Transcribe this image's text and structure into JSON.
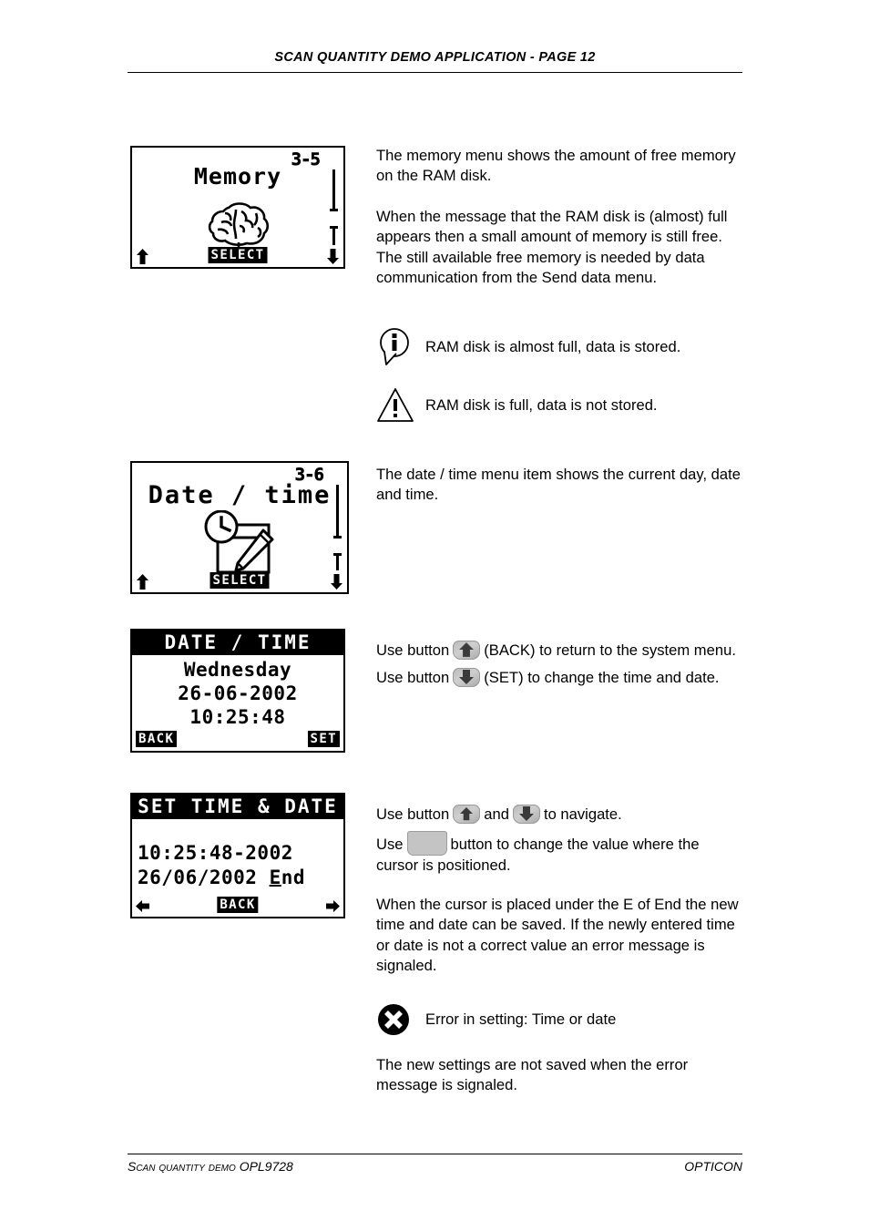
{
  "header": {
    "title": "SCAN QUANTITY DEMO APPLICATION  -   PAGE 12"
  },
  "footer": {
    "left_smallcaps": "Scan quantity demo ",
    "left_model": "OPL9728",
    "right": "OPTICON"
  },
  "screens": [
    {
      "id": "memory-menu",
      "page_no": "3-5",
      "title": "Memory",
      "icon": "brain-icon",
      "softkey_center": "SELECT",
      "arrow_left": "up-arrow",
      "arrow_right": "down-arrow",
      "scrollbar": true
    },
    {
      "id": "date-time-menu",
      "page_no": "3-6",
      "title": "Date / time",
      "icon": "clock-calendar-pencil-icon",
      "softkey_center": "SELECT",
      "arrow_left": "up-arrow",
      "arrow_right": "down-arrow",
      "scrollbar": true
    },
    {
      "id": "date-time-display",
      "bar_title": "DATE / TIME",
      "lines": [
        "Wednesday",
        "26-06-2002",
        "10:25:48"
      ],
      "softkey_left": "BACK",
      "softkey_right": "SET"
    },
    {
      "id": "set-time-date",
      "bar_title": "SET TIME & DATE",
      "line1": "10:25:48-2002",
      "line2_prefix": "26/06/2002 ",
      "line2_cursor": "E",
      "line2_suffix": "nd",
      "softkey_center": "BACK",
      "arrow_left": "left-arrow",
      "arrow_right": "right-arrow"
    }
  ],
  "sections": {
    "memory": {
      "p1": "The memory menu shows the amount of free memory on the RAM disk.",
      "p2": "When the message that the RAM disk is (almost) full appears then a small amount of memory is still free. The still available free memory is needed by data communication from the Send data menu.",
      "note_info": "RAM disk is almost full, data is stored.",
      "note_warning": "RAM disk is full, data is not stored."
    },
    "datetime": {
      "p1": "The date / time menu item shows the current day, date and time."
    },
    "datetime_buttons": {
      "use_button_1_pre": "Use button",
      "use_button_1_post": "(BACK) to return to the system menu.",
      "use_button_2_pre": "Use button",
      "use_button_2_post": "(SET) to change the time and date."
    },
    "settime": {
      "nav_pre": "Use button",
      "nav_mid": "and",
      "nav_post": "to navigate.",
      "value_pre": "Use",
      "value_post": "button to change the value where the cursor is positioned.",
      "p1": "When the cursor is placed under the E of End the new time and date can be saved. If the newly entered time or date is not a correct value an error message is signaled.",
      "note_error": "Error in setting: Time or date",
      "p2": "The new settings are not saved when the error message is signaled."
    }
  },
  "colors": {
    "ink": "#000000",
    "paper": "#ffffff",
    "button_face": "#c4c4c4"
  }
}
